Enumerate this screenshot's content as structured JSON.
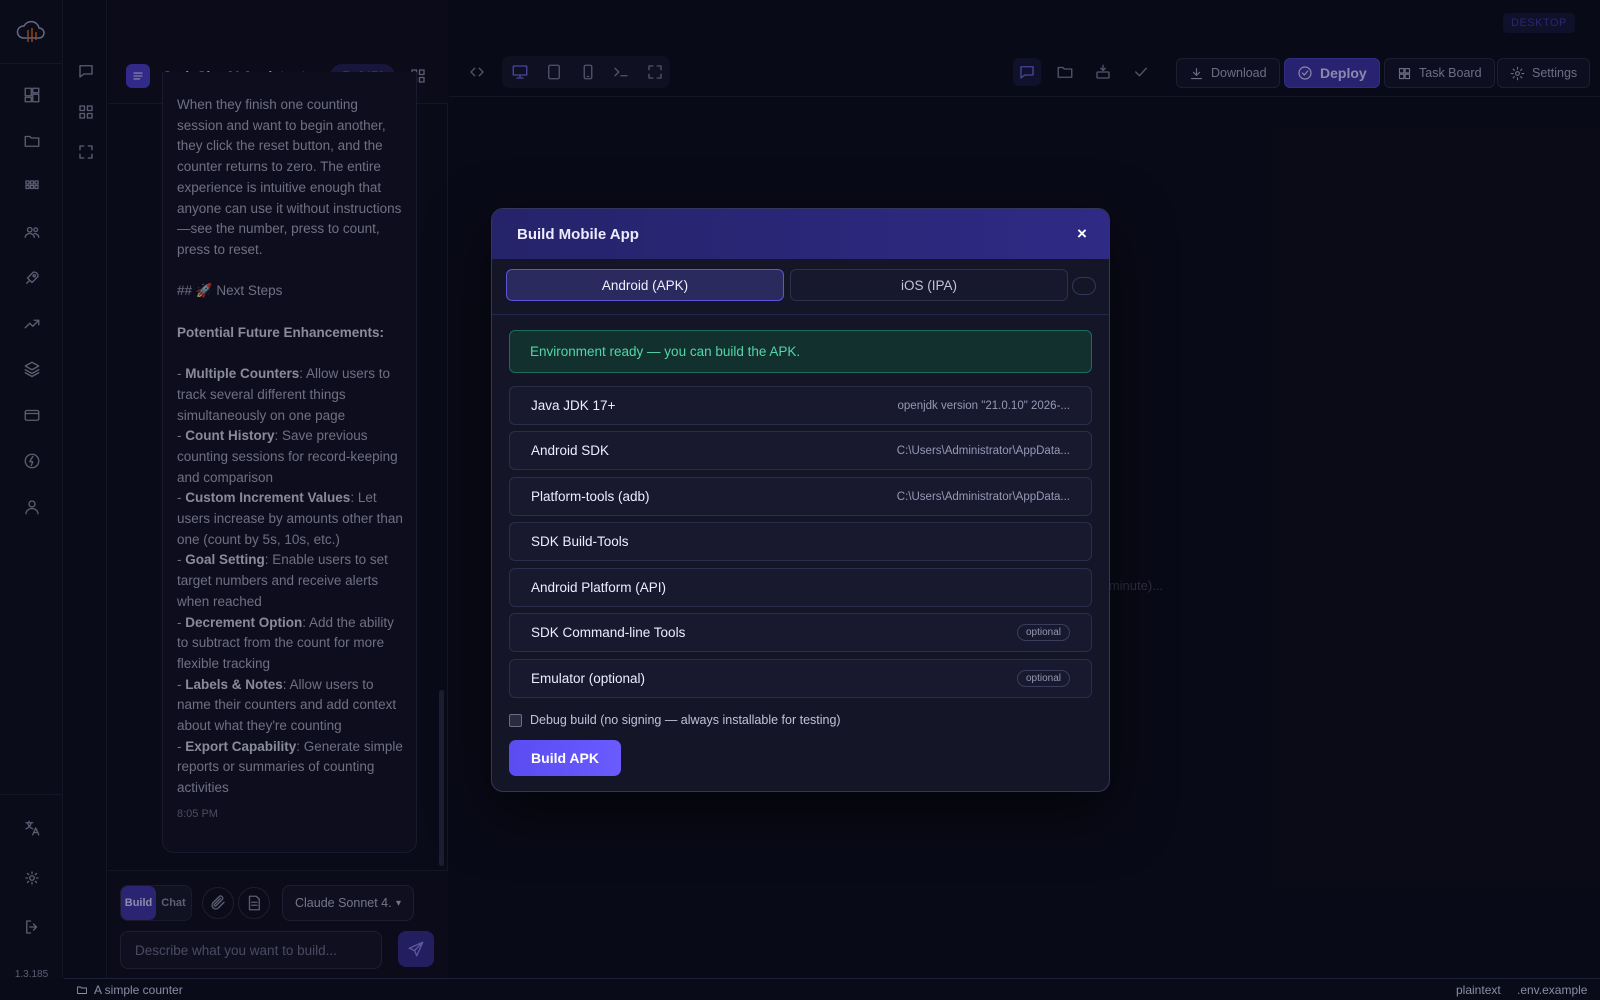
{
  "app": {
    "version": "1.3.185",
    "desktop_badge": "DESKTOP"
  },
  "rail": {
    "icons": [
      "dashboard-icon",
      "folder-icon",
      "apps-icon",
      "users-icon",
      "rocket-icon",
      "trending-icon",
      "layers-icon",
      "card-icon",
      "bolt-icon",
      "user-icon"
    ],
    "bottom_icons": [
      "translate-icon",
      "sun-icon",
      "logout-icon"
    ]
  },
  "chat": {
    "title": "CodeSky AI Assistant",
    "credits": "3470",
    "message_lines": [
      "When they finish one counting session and want to begin another, they click the reset button, and the counter returns to zero. The entire experience is intuitive enough that anyone can use it without instructions—see the number, press to count, press to reset."
    ],
    "next_steps_heading": "## 🚀 Next Steps",
    "enhancements_heading": "Potential Future Enhancements:",
    "enhancements": [
      {
        "title": "Multiple Counters",
        "text": ": Allow users to track several different things simultaneously on one page"
      },
      {
        "title": "Count History",
        "text": ": Save previous counting sessions for record-keeping and comparison"
      },
      {
        "title": "Custom Increment Values",
        "text": ": Let users increase by amounts other than one (count by 5s, 10s, etc.)"
      },
      {
        "title": "Goal Setting",
        "text": ": Enable users to set target numbers and receive alerts when reached"
      },
      {
        "title": "Decrement Option",
        "text": ": Add the ability to subtract from the count for more flexible tracking"
      },
      {
        "title": "Labels & Notes",
        "text": ": Allow users to name their counters and add context about what they're counting"
      },
      {
        "title": "Export Capability",
        "text": ": Generate simple reports or summaries of counting activities"
      }
    ],
    "time": "8:05 PM",
    "mode_build": "Build",
    "mode_chat": "Chat",
    "model": "Claude Sonnet 4.",
    "input_placeholder": "Describe what you want to build..."
  },
  "toolbar": {
    "download": "Download",
    "deploy": "Deploy",
    "task_board": "Task Board",
    "settings": "Settings"
  },
  "background_text": "a minute)...",
  "modal": {
    "title": "Build Mobile App",
    "close": "×",
    "tabs": [
      {
        "label": "Android (APK)",
        "active": true
      },
      {
        "label": "iOS (IPA)",
        "active": false
      }
    ],
    "env_status": "Environment ready — you can build the APK.",
    "requirements": [
      {
        "name": "Java JDK 17+",
        "detail": "openjdk version \"21.0.10\" 2026-...",
        "badge": ""
      },
      {
        "name": "Android SDK",
        "detail": "C:\\Users\\Administrator\\AppData...",
        "badge": ""
      },
      {
        "name": "Platform-tools (adb)",
        "detail": "C:\\Users\\Administrator\\AppData...",
        "badge": ""
      },
      {
        "name": "SDK Build-Tools",
        "detail": "",
        "badge": ""
      },
      {
        "name": "Android Platform (API)",
        "detail": "",
        "badge": ""
      },
      {
        "name": "SDK Command-line Tools",
        "detail": "",
        "badge": "optional"
      },
      {
        "name": "Emulator (optional)",
        "detail": "",
        "badge": "optional"
      }
    ],
    "debug_label": "Debug build (no signing — always installable for testing)",
    "debug_checked": false,
    "build_button": "Build APK"
  },
  "statusbar": {
    "project": "A simple counter",
    "language": "plaintext",
    "file": ".env.example"
  }
}
